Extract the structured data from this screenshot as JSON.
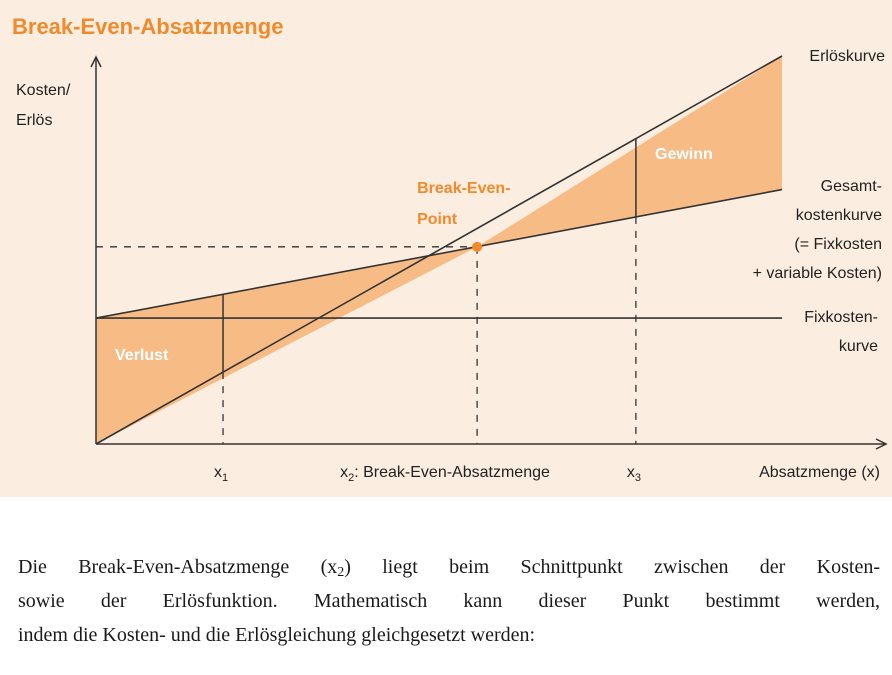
{
  "title": "Break-Even-Absatzmenge",
  "colors": {
    "accent": "#f08a2c",
    "fill": "#f7bb86",
    "background": "#fbeee0",
    "line": "#333333"
  },
  "chart_data": {
    "type": "area",
    "title": "Break-Even-Absatzmenge",
    "ylabel_lines": [
      "Kosten/",
      "Erlös"
    ],
    "xlabel": "Absatzmenge (x)",
    "x_ticks": [
      {
        "main": "x",
        "sub": "1",
        "rest": "",
        "x": 1
      },
      {
        "main": "x",
        "sub": "2",
        "rest": ": Break-Even-Absatzmenge",
        "x": 3
      },
      {
        "main": "x",
        "sub": "3",
        "rest": "",
        "x": 4.25
      }
    ],
    "xlim": [
      0,
      5.4
    ],
    "ylim": [
      0,
      6.1
    ],
    "grid": false,
    "series": [
      {
        "name": "Erlöskurve",
        "x": [
          0,
          5.4
        ],
        "y": [
          0,
          6.1
        ]
      },
      {
        "name": "Gesamtkostenkurve (= Fixkosten + variable Kosten)",
        "x": [
          0,
          5.4
        ],
        "y": [
          1.98,
          4.0
        ]
      },
      {
        "name": "Fixkostenkurve",
        "x": [
          0,
          5.4
        ],
        "y": [
          1.98,
          1.98
        ]
      }
    ],
    "curve_labels": [
      {
        "lines": [
          "Erlöskurve"
        ]
      },
      {
        "lines": [
          "Gesamt-",
          "kostenkurve",
          "(= Fixkosten",
          "+ variable Kosten)"
        ]
      },
      {
        "lines": [
          "Fixkosten-",
          "kurve"
        ]
      }
    ],
    "break_even_point": {
      "x": 3,
      "y": 3.1,
      "label_lines": [
        "Break-Even-",
        "Point"
      ]
    },
    "regions": [
      {
        "label": "Verlust"
      },
      {
        "label": "Gewinn"
      }
    ]
  },
  "paragraph": {
    "line1_a": "Die Break-Even-Absatzmenge (x",
    "line1_sub": "2",
    "line1_b": ") liegt beim Schnittpunkt zwischen der Kosten-",
    "line2": "sowie der Erlösfunktion. Mathematisch kann dieser Punkt bestimmt werden,",
    "line3": "indem die Kosten- und die Erlösgleichung gleichgesetzt werden:"
  }
}
